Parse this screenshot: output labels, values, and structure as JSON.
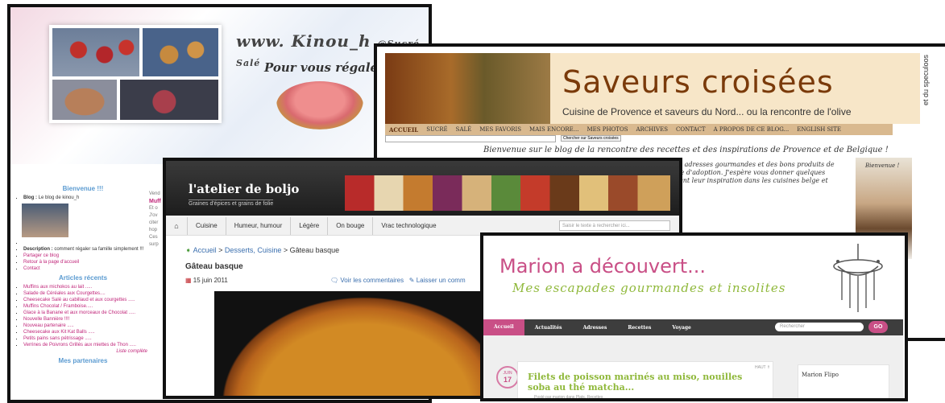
{
  "kinou": {
    "brand": "www. Kinou_h",
    "brand_suffix": "@Sucré Salé",
    "tagline": "Pour vous régaler",
    "tagline_mark": "!!",
    "side_title": "Bienvenue !!!",
    "blog_label": "Blog :",
    "blog_value": "Le blog de kinou_h",
    "desc_label": "Description :",
    "desc_value": "comment régaler sa famille simplement !!!",
    "links": [
      "Partager ce blog",
      "Retour à la page d'accueil",
      "Contact"
    ],
    "recent_title": "Articles récents",
    "recent": [
      "Muffins aux michokos au lait .....",
      "Salade de Céréales aux Courgettes....",
      "Cheesecake Salé au cabillaud et aux courgettes .....",
      "Muffins Chocolat / Framboise.....",
      "Glace à la Banane et aux morceaux de Chocolat .....",
      "Nouvelle Bannière !!!!",
      "Nouveau partenaire .....",
      "Cheesecake aux Kit Kat Balls .....",
      "Petits pains sans pétrissage .....",
      "Verrines de Poivrons Grillés aux miettes de Thon ....."
    ],
    "more": "Liste complète",
    "bottom_title": "Mes partenaires",
    "mid_date": "Vend",
    "mid_heading": "Muff",
    "mid_lines": [
      "Et o",
      "J'ov",
      "citer",
      "hop",
      "Ces",
      "surp"
    ]
  },
  "saveurs": {
    "title": "Saveurs croisées",
    "subtitle": "Cuisine de Provence et saveurs du Nord... ou la rencontre de l'olive",
    "vertical": "et du speculoos",
    "nav": [
      "ACCUEIL",
      "SUCRÉ",
      "SALÉ",
      "MES FAVORIS",
      "MAIS ENCORE...",
      "MES PHOTOS",
      "ARCHIVES",
      "CONTACT",
      "A PROPOS DE CE BLOG...",
      "ENGLISH SITE"
    ],
    "search_btn": "Chercher sur Saveurs croisées",
    "welcome": "Bienvenue sur le blog de la rencontre des recettes et des inspirations de Provence et de Belgique !",
    "body_lines": [
      ", des adresses gourmandes et des bons produits de",
      "rique d'adoption. J'espère vous donner quelques",
      "ennent leur inspiration dans les cuisines belge et"
    ],
    "portrait_caption": "Bienvenue !"
  },
  "boljo": {
    "logo": "l'atelier de boljo",
    "slogan": "Graines d'épices et grains de folie",
    "menu": [
      "Cuisine",
      "Humeur, humour",
      "Légère",
      "On bouge",
      "Vrac technologique"
    ],
    "search_placeholder": "Saisir le texte à rechercher ici...",
    "crumb_home": "Accueil",
    "crumb_cat": "Desserts, Cuisine",
    "crumb_current": "Gâteau basque",
    "post_title": "Gâteau basque",
    "date": "15 juin 2011",
    "comments": "Voir les commentaires",
    "leave": "Laisser un comm"
  },
  "marion": {
    "title": "Marion a découvert...",
    "subtitle": "Mes escapades gourmandes et insolites",
    "nav": [
      "Accueil",
      "Actualités",
      "Adresses",
      "Recettes",
      "Voyage"
    ],
    "search_placeholder": "Rechercher",
    "go": "GO",
    "date_month": "JUIN",
    "date_day": "17",
    "post_title": "Filets de poisson marinés au miso, nouilles soba au thé matcha...",
    "post_by": "Posté par marion dans Plats, Recettes",
    "haut": "HAUT ⇑",
    "side_name": "Marion Flipo"
  },
  "colors": {
    "pink": "#c94f86",
    "green": "#8fb83a",
    "brown": "#7a3a0a"
  }
}
